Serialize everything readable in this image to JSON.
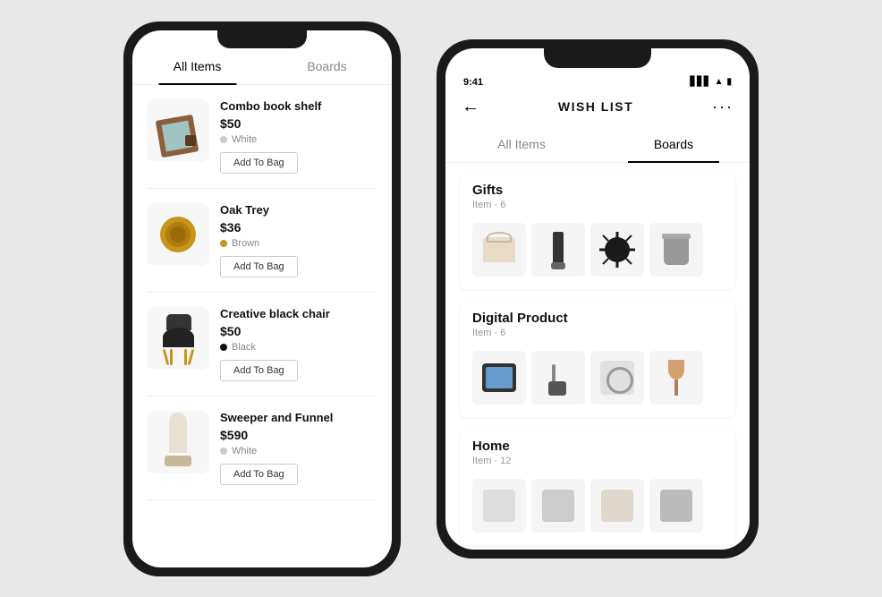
{
  "left_phone": {
    "tab_all_items": "All Items",
    "tab_boards": "Boards",
    "products": [
      {
        "name": "Combo book shelf",
        "price": "$50",
        "color": "White",
        "color_hex": "#ccc",
        "btn_label": "Add To Bag"
      },
      {
        "name": "Oak Trey",
        "price": "$36",
        "color": "Brown",
        "color_hex": "#c8941a",
        "btn_label": "Add To Bag"
      },
      {
        "name": "Creative black chair",
        "price": "$50",
        "color": "Black",
        "color_hex": "#111",
        "btn_label": "Add To Bag"
      },
      {
        "name": "Sweeper and Funnel",
        "price": "$590",
        "color": "White",
        "color_hex": "#ccc",
        "btn_label": "Add To Bag"
      }
    ]
  },
  "right_phone": {
    "status_time": "9:41",
    "back_icon": "←",
    "title": "WISH LIST",
    "more_icon": "···",
    "tab_all_items": "All Items",
    "tab_boards": "Boards",
    "boards": [
      {
        "title": "Gifts",
        "count": "Item · 6"
      },
      {
        "title": "Digital Product",
        "count": "Item · 6"
      },
      {
        "title": "Home",
        "count": "Item · 12"
      }
    ]
  }
}
